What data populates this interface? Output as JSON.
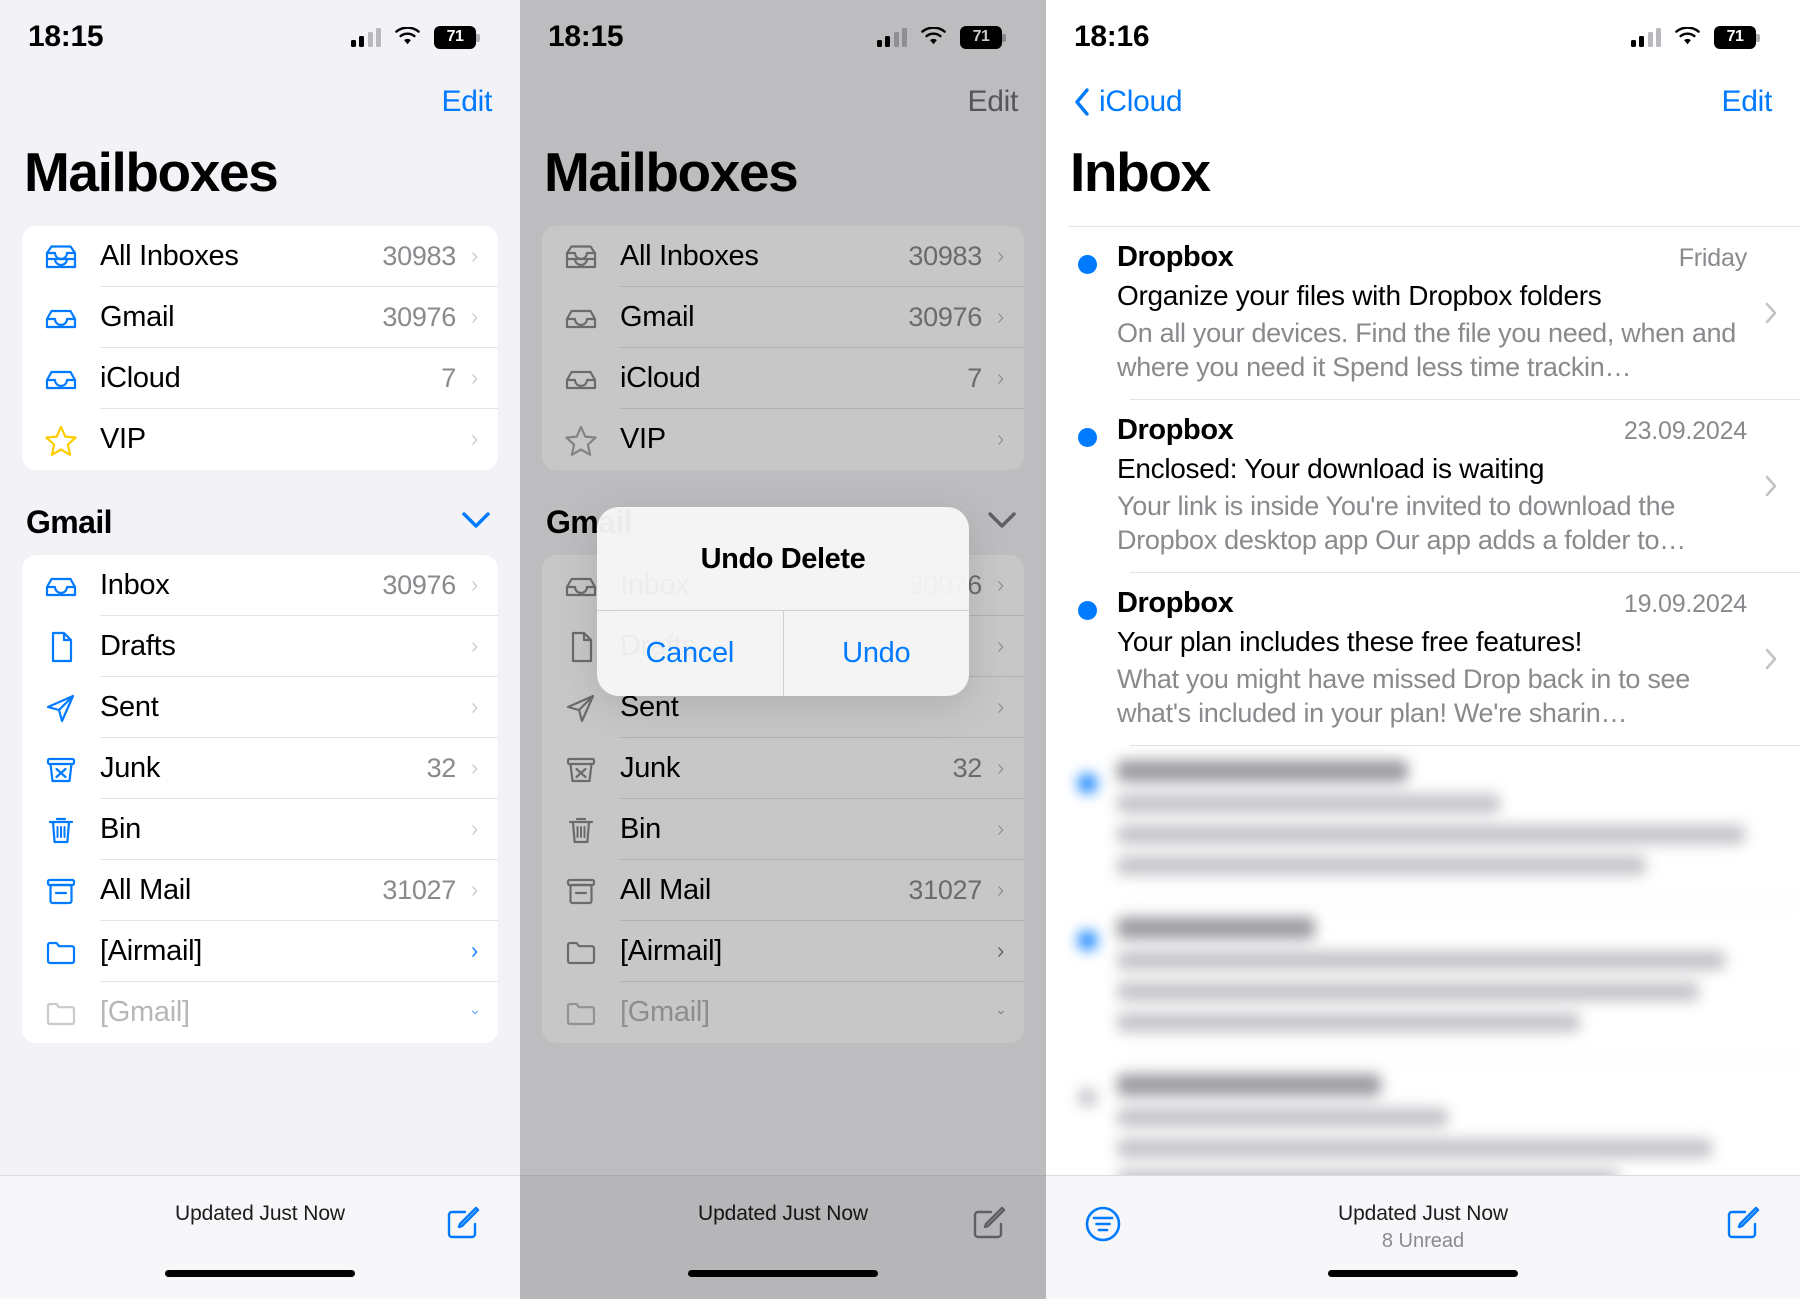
{
  "panels": [
    {
      "id": "mailboxes",
      "statusbar": {
        "time": "18:15",
        "battery": "71"
      },
      "nav": {
        "edit": "Edit"
      },
      "title": "Mailboxes",
      "accounts": [
        {
          "label": "All Inboxes",
          "count": "30983",
          "icon": "all-inboxes-icon"
        },
        {
          "label": "Gmail",
          "count": "30976",
          "icon": "inbox-tray-icon"
        },
        {
          "label": "iCloud",
          "count": "7",
          "icon": "inbox-tray-icon"
        },
        {
          "label": "VIP",
          "count": "",
          "icon": "star-icon"
        }
      ],
      "section": {
        "title": "Gmail"
      },
      "folders": [
        {
          "label": "Inbox",
          "count": "30976",
          "icon": "inbox-tray-icon"
        },
        {
          "label": "Drafts",
          "count": "",
          "icon": "document-icon"
        },
        {
          "label": "Sent",
          "count": "",
          "icon": "paper-plane-icon"
        },
        {
          "label": "Junk",
          "count": "32",
          "icon": "junk-bin-icon"
        },
        {
          "label": "Bin",
          "count": "",
          "icon": "trash-icon"
        },
        {
          "label": "All Mail",
          "count": "31027",
          "icon": "archive-box-icon"
        },
        {
          "label": "[Airmail]",
          "count": "",
          "icon": "folder-icon"
        },
        {
          "label": "[Gmail]",
          "count": "",
          "icon": "folder-icon"
        }
      ],
      "toolbar": {
        "status": "Updated Just Now",
        "compose": "compose-icon"
      }
    },
    {
      "id": "mailboxes-dimmed",
      "statusbar": {
        "time": "18:15",
        "battery": "71"
      },
      "nav": {
        "edit": "Edit"
      },
      "title": "Mailboxes",
      "accounts": [
        {
          "label": "All Inboxes",
          "count": "30983",
          "icon": "all-inboxes-icon"
        },
        {
          "label": "Gmail",
          "count": "30976",
          "icon": "inbox-tray-icon"
        },
        {
          "label": "iCloud",
          "count": "7",
          "icon": "inbox-tray-icon"
        },
        {
          "label": "VIP",
          "count": "",
          "icon": "star-icon"
        }
      ],
      "section": {
        "title": "Gmail"
      },
      "folders": [
        {
          "label": "Inbox",
          "count": "30976",
          "icon": "inbox-tray-icon"
        },
        {
          "label": "Drafts",
          "count": "",
          "icon": "document-icon"
        },
        {
          "label": "Sent",
          "count": "",
          "icon": "paper-plane-icon"
        },
        {
          "label": "Junk",
          "count": "32",
          "icon": "junk-bin-icon"
        },
        {
          "label": "Bin",
          "count": "",
          "icon": "trash-icon"
        },
        {
          "label": "All Mail",
          "count": "31027",
          "icon": "archive-box-icon"
        },
        {
          "label": "[Airmail]",
          "count": "",
          "icon": "folder-icon"
        },
        {
          "label": "[Gmail]",
          "count": "",
          "icon": "folder-icon"
        }
      ],
      "alert": {
        "title": "Undo Delete",
        "cancel": "Cancel",
        "confirm": "Undo"
      },
      "toolbar": {
        "status": "Updated Just Now",
        "compose": "compose-icon"
      }
    },
    {
      "id": "inbox",
      "statusbar": {
        "time": "18:16",
        "battery": "71"
      },
      "nav": {
        "back": "iCloud",
        "edit": "Edit"
      },
      "title": "Inbox",
      "messages": [
        {
          "sender": "Dropbox",
          "date": "Friday",
          "subject": "Organize your files with Dropbox folders",
          "preview": "On all your devices. Find the file you need, when and where you need it Spend less time trackin…",
          "unread": true
        },
        {
          "sender": "Dropbox",
          "date": "23.09.2024",
          "subject": "Enclosed: Your download is waiting",
          "preview": "Your link is inside You're invited to download the Dropbox desktop app Our app adds a folder to…",
          "unread": true
        },
        {
          "sender": "Dropbox",
          "date": "19.09.2024",
          "subject": "Your plan includes these free features!",
          "preview": "What you might have missed Drop back in to see what's included in your plan! We're sharin…",
          "unread": true
        }
      ],
      "toolbar": {
        "filter": "filter-icon",
        "status": "Updated Just Now",
        "unread": "8 Unread",
        "compose": "compose-icon"
      }
    }
  ],
  "colors": {
    "accent": "#007aff",
    "star": "#ffcc00",
    "grouped_bg": "#f2f2f7",
    "muted_text": "#8a8a8e"
  }
}
